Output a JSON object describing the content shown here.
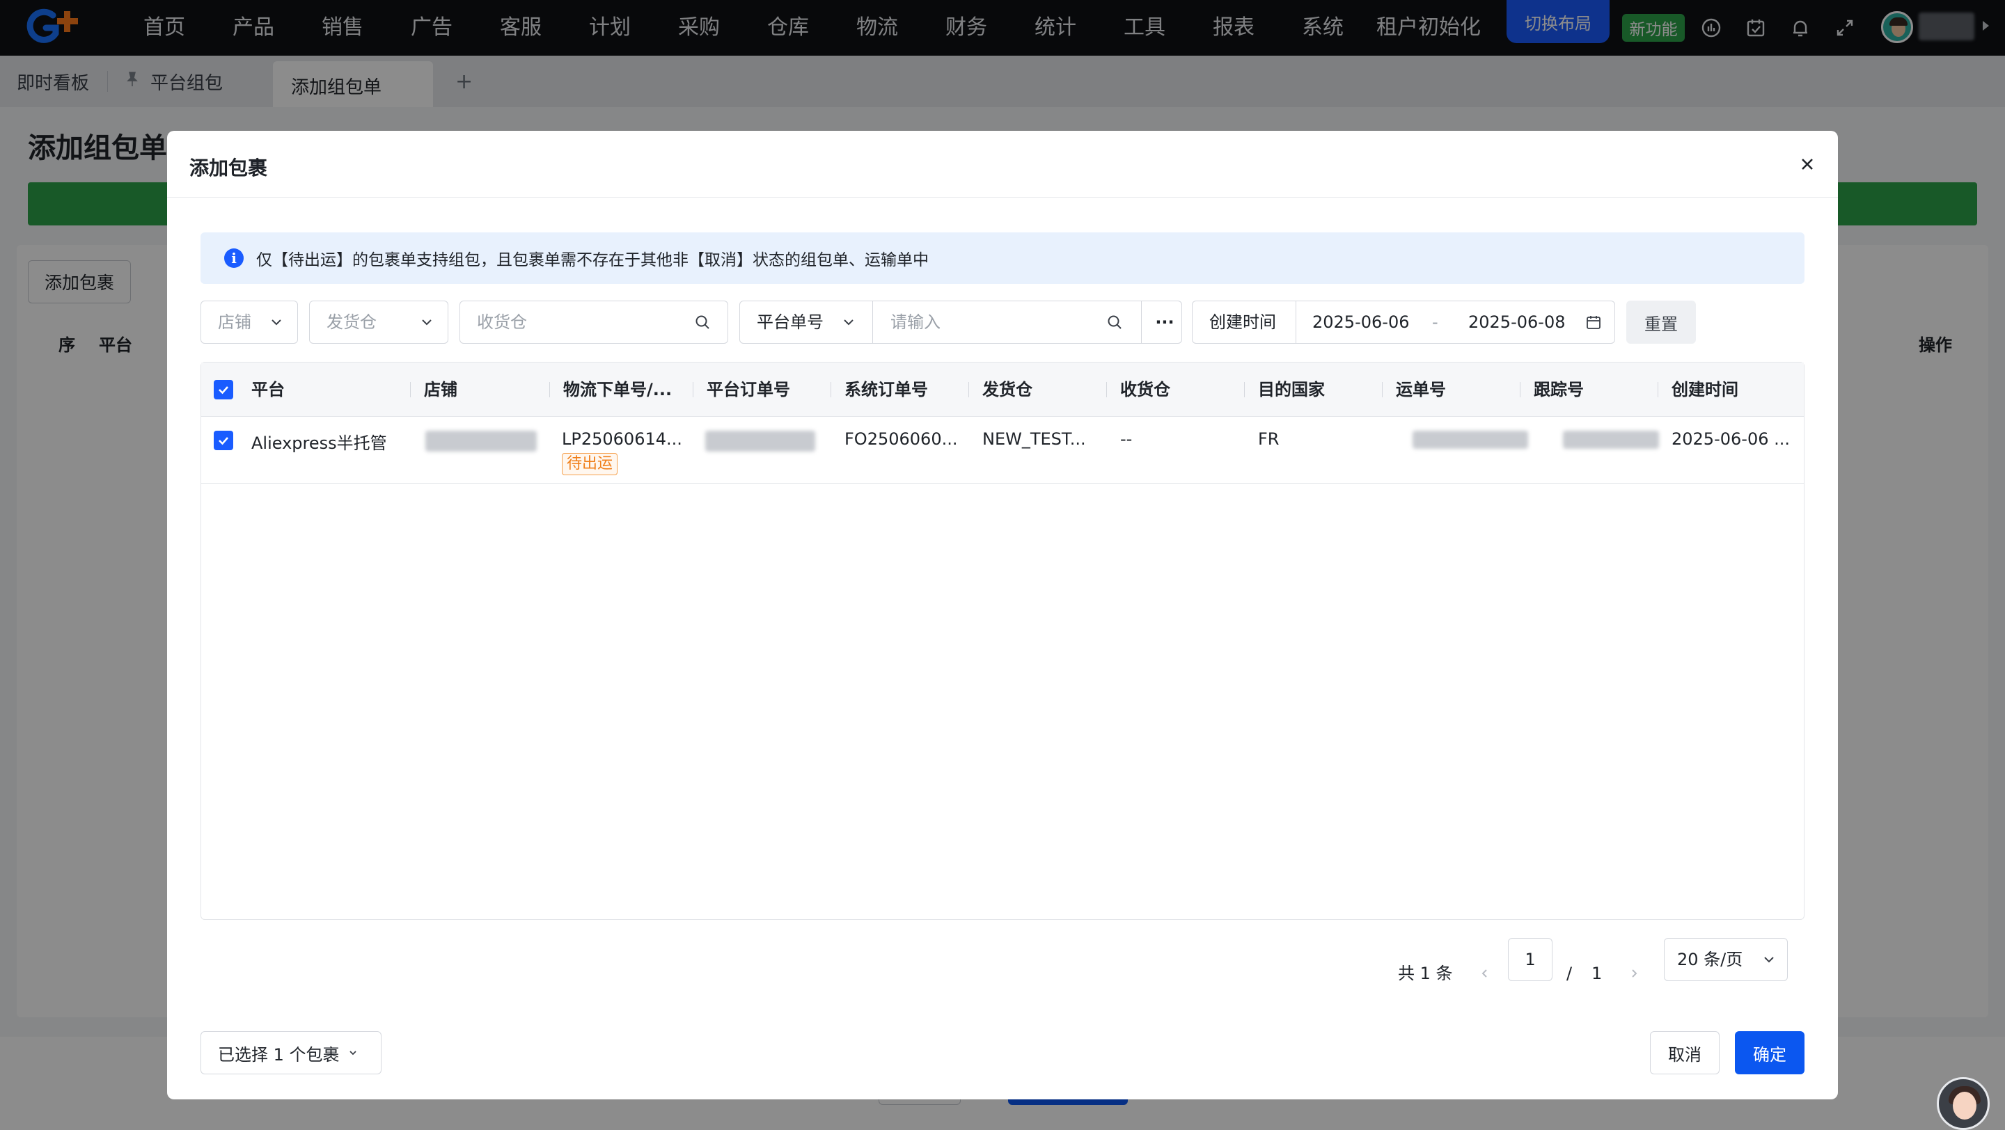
{
  "nav": {
    "logo_icon": "brand-logo-icon",
    "items": [
      "首页",
      "产品",
      "销售",
      "广告",
      "客服",
      "计划",
      "采购",
      "仓库",
      "物流",
      "财务",
      "统计",
      "工具",
      "报表",
      "系统",
      "租户初始化"
    ],
    "switch_layout": "切换布局",
    "new_feature": "新功能",
    "icons": [
      "chart-icon",
      "calendar-check-icon",
      "bell-icon",
      "fullscreen-icon"
    ],
    "accent": "#1a5cff"
  },
  "tabs": {
    "items": [
      "即时看板",
      "平台组包",
      "添加组包单"
    ],
    "add": "+"
  },
  "page": {
    "title": "添加组包单",
    "add_package_btn": "添加包裹",
    "col_seq": "序",
    "col_platform": "平台",
    "col_action": "操作"
  },
  "modal": {
    "title": "添加包裹",
    "close_icon": "close-icon",
    "notice": "仅【待出运】的包裹单支持组包，且包裹单需不存在于其他非【取消】状态的组包单、运输单中",
    "filters": {
      "shop_placeholder": "店铺",
      "ship_warehouse_placeholder": "发货仓",
      "recv_warehouse_placeholder": "收货仓",
      "order_type": "平台单号",
      "order_input_placeholder": "请输入",
      "more": "···",
      "date_label": "创建时间",
      "date_from": "2025-06-06",
      "date_sep": "-",
      "date_to": "2025-06-08",
      "reset": "重置"
    },
    "table": {
      "columns": [
        "平台",
        "店铺",
        "物流下单号/...",
        "平台订单号",
        "系统订单号",
        "发货仓",
        "收货仓",
        "目的国家",
        "运单号",
        "跟踪号",
        "创建时间"
      ],
      "rows": [
        {
          "checked": true,
          "platform": "Aliexpress半托管",
          "shop": "",
          "logistics_no": "LP25060614...",
          "status": "待出运",
          "platform_order": "",
          "system_order": "FO2506060...",
          "ship_warehouse": "NEW_TEST...",
          "recv_warehouse": "--",
          "country": "FR",
          "waybill": "",
          "tracking": "",
          "created": "2025-06-06 ..."
        }
      ]
    },
    "pagination": {
      "total": "共 1 条",
      "page": "1",
      "slash": "/",
      "pages": "1",
      "size": "20 条/页"
    },
    "footer": {
      "selected": "已选择 1 个包裹",
      "cancel": "取消",
      "confirm": "确定"
    }
  },
  "assistant_icon": "assistant-avatar-icon"
}
